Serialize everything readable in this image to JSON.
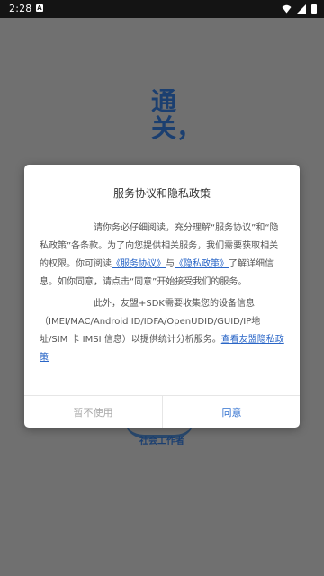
{
  "status": {
    "time": "2:28",
    "notif_icon": "a-notification-icon"
  },
  "background": {
    "title": "通关，",
    "footer": "社会工作者"
  },
  "dialog": {
    "title": "服务协议和隐私政策",
    "p1_a": "请你务必仔细阅读，充分理解“服务协议”和“隐私政策”各条款。为了向您提供相关服务，我们需要获取相关的权限。你可阅读",
    "link_service": "《服务协议》",
    "p1_and": "与",
    "link_privacy": "《隐私政策》",
    "p1_b": "了解详细信息。如你同意，请点击“同意”开始接受我们的服务。",
    "p2": "此外，友盟+SDK需要收集您的设备信息（IMEI/MAC/Android ID/IDFA/OpenUDID/GUID/IP地址/SIM 卡 IMSI 信息）以提供统计分析服务。",
    "link_umeng": "查看友盟隐私政策",
    "btn_decline": "暂不使用",
    "btn_agree": "同意"
  }
}
